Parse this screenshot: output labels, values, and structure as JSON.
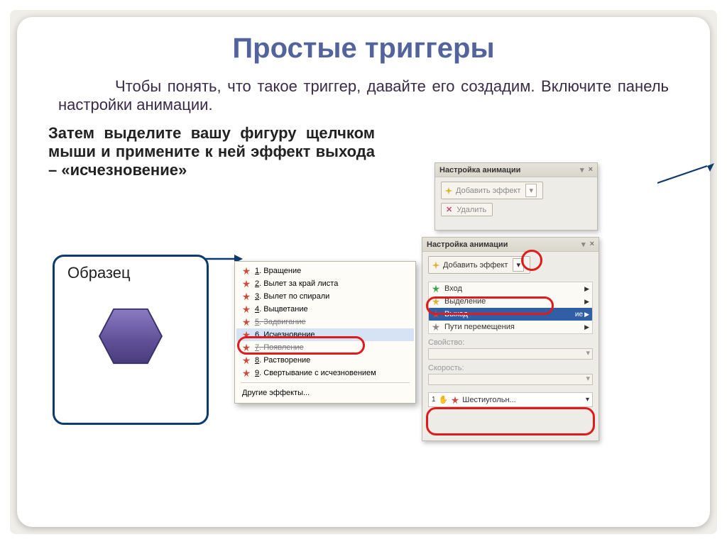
{
  "title": "Простые триггеры",
  "para1_a": "Чтобы понять, что такое триггер, давайте его создадим. Включите панель настройки анимации.",
  "para2": "Затем выделите вашу фигуру щелчком мыши и примените к ней эффект выхода – «исчезновение»",
  "sample_label": "Образец",
  "panel": {
    "title": "Настройка анимации",
    "add_effect": "Добавить эффект",
    "remove": "Удалить"
  },
  "menu": {
    "entrance": "Вход",
    "emphasis": "Выделение",
    "exit": "Выход",
    "motion": "Пути перемещения",
    "modify_hint": "ие"
  },
  "fields": {
    "property": "Свойство:",
    "speed": "Скорость:",
    "object_num": "1",
    "object_name": "Шестиугольн..."
  },
  "effects": {
    "items": [
      {
        "n": "1",
        "label": "Вращение"
      },
      {
        "n": "2",
        "label": "Вылет за край листа"
      },
      {
        "n": "3",
        "label": "Вылет по спирали"
      },
      {
        "n": "4",
        "label": "Выцветание"
      },
      {
        "n": "5",
        "label": "Задвигание"
      },
      {
        "n": "6",
        "label": "Исчезновение"
      },
      {
        "n": "7",
        "label": "Появление"
      },
      {
        "n": "8",
        "label": "Растворение"
      },
      {
        "n": "9",
        "label": "Свертывание с исчезновением"
      }
    ],
    "other": "Другие эффекты..."
  },
  "icons": {
    "star_green": "#3ea24b",
    "star_yellow": "#d9b33a",
    "star_red": "#cc4a3a",
    "star_orange": "#d98a3a",
    "hex_fill": "#6b5ca3",
    "hex_stroke": "#3a3166",
    "frame": "#0f3a6e"
  }
}
